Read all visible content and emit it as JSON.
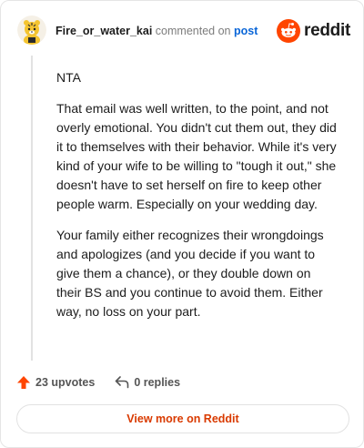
{
  "comment": {
    "username": "Fire_or_water_kai",
    "action_text": "commented on",
    "post_link": "post",
    "paragraphs": [
      "NTA",
      "That email was well written, to the point, and not overly emotional. You didn't cut them out, they did it to themselves with their behavior. While it's very kind of your wife to be willing to \"tough it out,\" she doesn't have to set herself on fire to keep other people warm. Especially on your wedding day.",
      "Your family either recognizes their wrongdoings and apologizes (and you decide if you want to give them a chance), or they double down on their BS and you continue to avoid them. Either way, no loss on your part."
    ]
  },
  "logo": {
    "wordmark": "reddit",
    "icon": "reddit-snoo-icon",
    "color": "#ff4500"
  },
  "actions": {
    "upvotes": "23 upvotes",
    "replies": "0 replies",
    "upvote_icon": "upvote-arrow-icon",
    "reply_icon": "reply-arrow-icon",
    "upvote_color": "#ff4500"
  },
  "footer": {
    "view_more": "View more on Reddit",
    "accent": "#d93a00"
  }
}
